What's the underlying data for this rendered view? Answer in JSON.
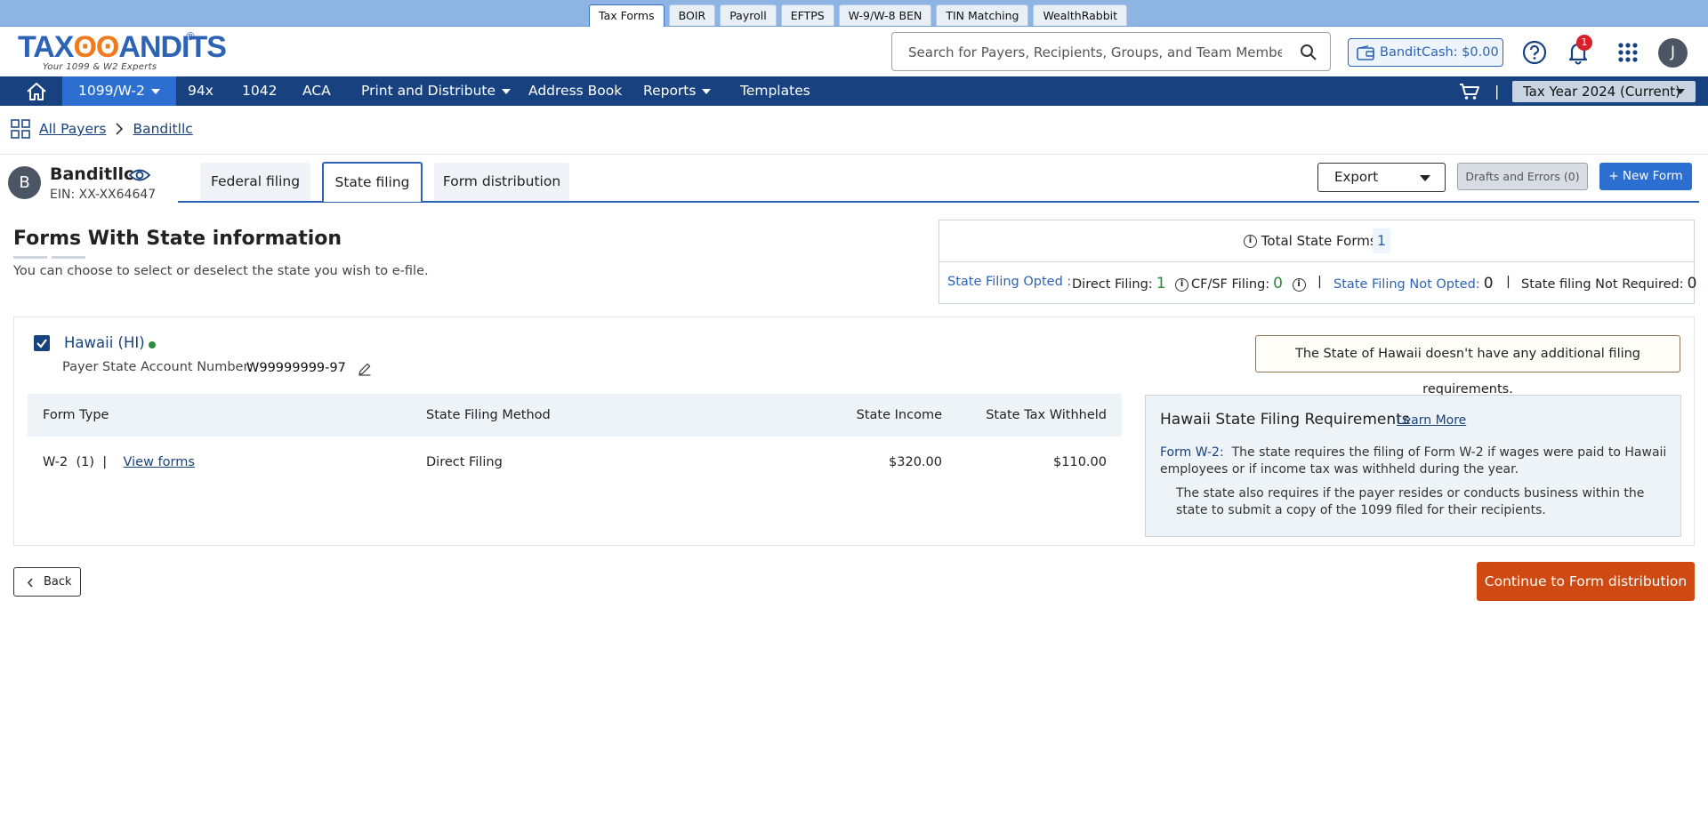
{
  "product_tabs": [
    "Tax Forms",
    "BOIR",
    "Payroll",
    "EFTPS",
    "W-9/W-8 BEN",
    "TIN Matching",
    "WealthRabbit"
  ],
  "logo": {
    "main_a": "TAX",
    "main_b": "ANDITS",
    "reg": "®",
    "tagline": "Your 1099 & W2 Experts"
  },
  "search": {
    "placeholder": "Search for Payers, Recipients, Groups, and Team Members"
  },
  "header": {
    "banditcash": "BanditCash: $0.00",
    "notif_count": "1",
    "user_initial": "J"
  },
  "nav": {
    "items": [
      "1099/W-2",
      "94x",
      "1042",
      "ACA",
      "Print and Distribute",
      "Address Book",
      "Reports",
      "Templates"
    ],
    "separator": "|",
    "tax_year": "Tax Year 2024 (Current)"
  },
  "breadcrumb": {
    "root": "All Payers",
    "current": "Banditllc"
  },
  "payer": {
    "initial": "B",
    "name": "Banditllc",
    "ein": "EIN: XX-XX64647"
  },
  "filing_tabs": [
    "Federal filing",
    "State filing",
    "Form distribution"
  ],
  "toolbar": {
    "export": "Export",
    "drafts": "Drafts and Errors (0)",
    "new_form": "+ New Form"
  },
  "section": {
    "title": "Forms With State information",
    "subtitle": "You can choose to select or deselect the state you wish to e-file."
  },
  "totals": {
    "label": "Total State Forms:",
    "value": "1",
    "opted_label": "State Filing Opted :",
    "direct_label": "Direct Filing:",
    "direct_val": "1",
    "cfsf_label": "CF/SF Filing:",
    "cfsf_val": "0",
    "not_opted_label": "State Filing Not Opted:",
    "not_opted_val": "0",
    "not_required_label": "State filing Not Required:",
    "not_required_val": "0",
    "sep": "|"
  },
  "state": {
    "name": "Hawaii (HI)",
    "acct_label": "Payer State Account Number:",
    "acct_value": "W99999999-97",
    "note": "The State of Hawaii doesn't have any additional filing requirements."
  },
  "table": {
    "headers": [
      "Form Type",
      "State Filing Method",
      "State Income",
      "State Tax Withheld"
    ],
    "row": {
      "form_type": "W-2",
      "count": "(1)",
      "sep": "|",
      "view": "View forms",
      "method": "Direct Filing",
      "income": "$320.00",
      "withheld": "$110.00"
    }
  },
  "requirements": {
    "title": "Hawaii State Filing Requirements",
    "learn_more": "Learn More",
    "form_label": "Form W-2:",
    "p1": "The state requires the filing of Form W-2 if wages were paid to Hawaii employees or if income tax was withheld during the year.",
    "p2": "The state also requires if the payer resides or conducts business within the state to submit a copy of the 1099 filed for their recipients."
  },
  "footer": {
    "back": "Back",
    "continue": "Continue to Form distribution"
  }
}
